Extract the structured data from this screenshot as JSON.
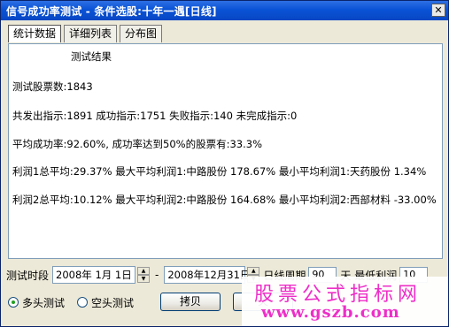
{
  "window": {
    "title": "信号成功率测试 - 条件选股:十年一遇[日线]",
    "close_label": "✕"
  },
  "tabs": [
    {
      "label": "统计数据",
      "active": true
    },
    {
      "label": "详细列表",
      "active": false
    },
    {
      "label": "分布图",
      "active": false
    }
  ],
  "results": {
    "heading": "测试结果",
    "lines": [
      "测试股票数:1843",
      "共发出指示:1891 成功指示:1751 失败指示:140 未完成指示:0",
      "平均成功率:92.60%, 成功率达到50%的股票有:33.3%",
      "利润1总平均:29.37% 最大平均利润1:中路股份 178.67% 最小平均利润1:天药股份 1.34%",
      "利润2总平均:10.12% 最大平均利润2:中路股份 164.68% 最小平均利润2:西部材料 -33.00%"
    ]
  },
  "period": {
    "label": "测试时段",
    "start": "2008年  1月  1日",
    "separator": "-",
    "end": "2008年12月31日",
    "extra_label_1": "日线周期",
    "extra_value_1": "90",
    "extra_label_2": "天 最低利润",
    "extra_value_2": "10"
  },
  "mode": {
    "long_label": "多头测试",
    "short_label": "空头测试",
    "selected": "long"
  },
  "buttons": {
    "copy": "拷贝",
    "other": "关"
  },
  "watermark": {
    "cn": "股票公式指标网",
    "url": "www.gszb.com"
  }
}
